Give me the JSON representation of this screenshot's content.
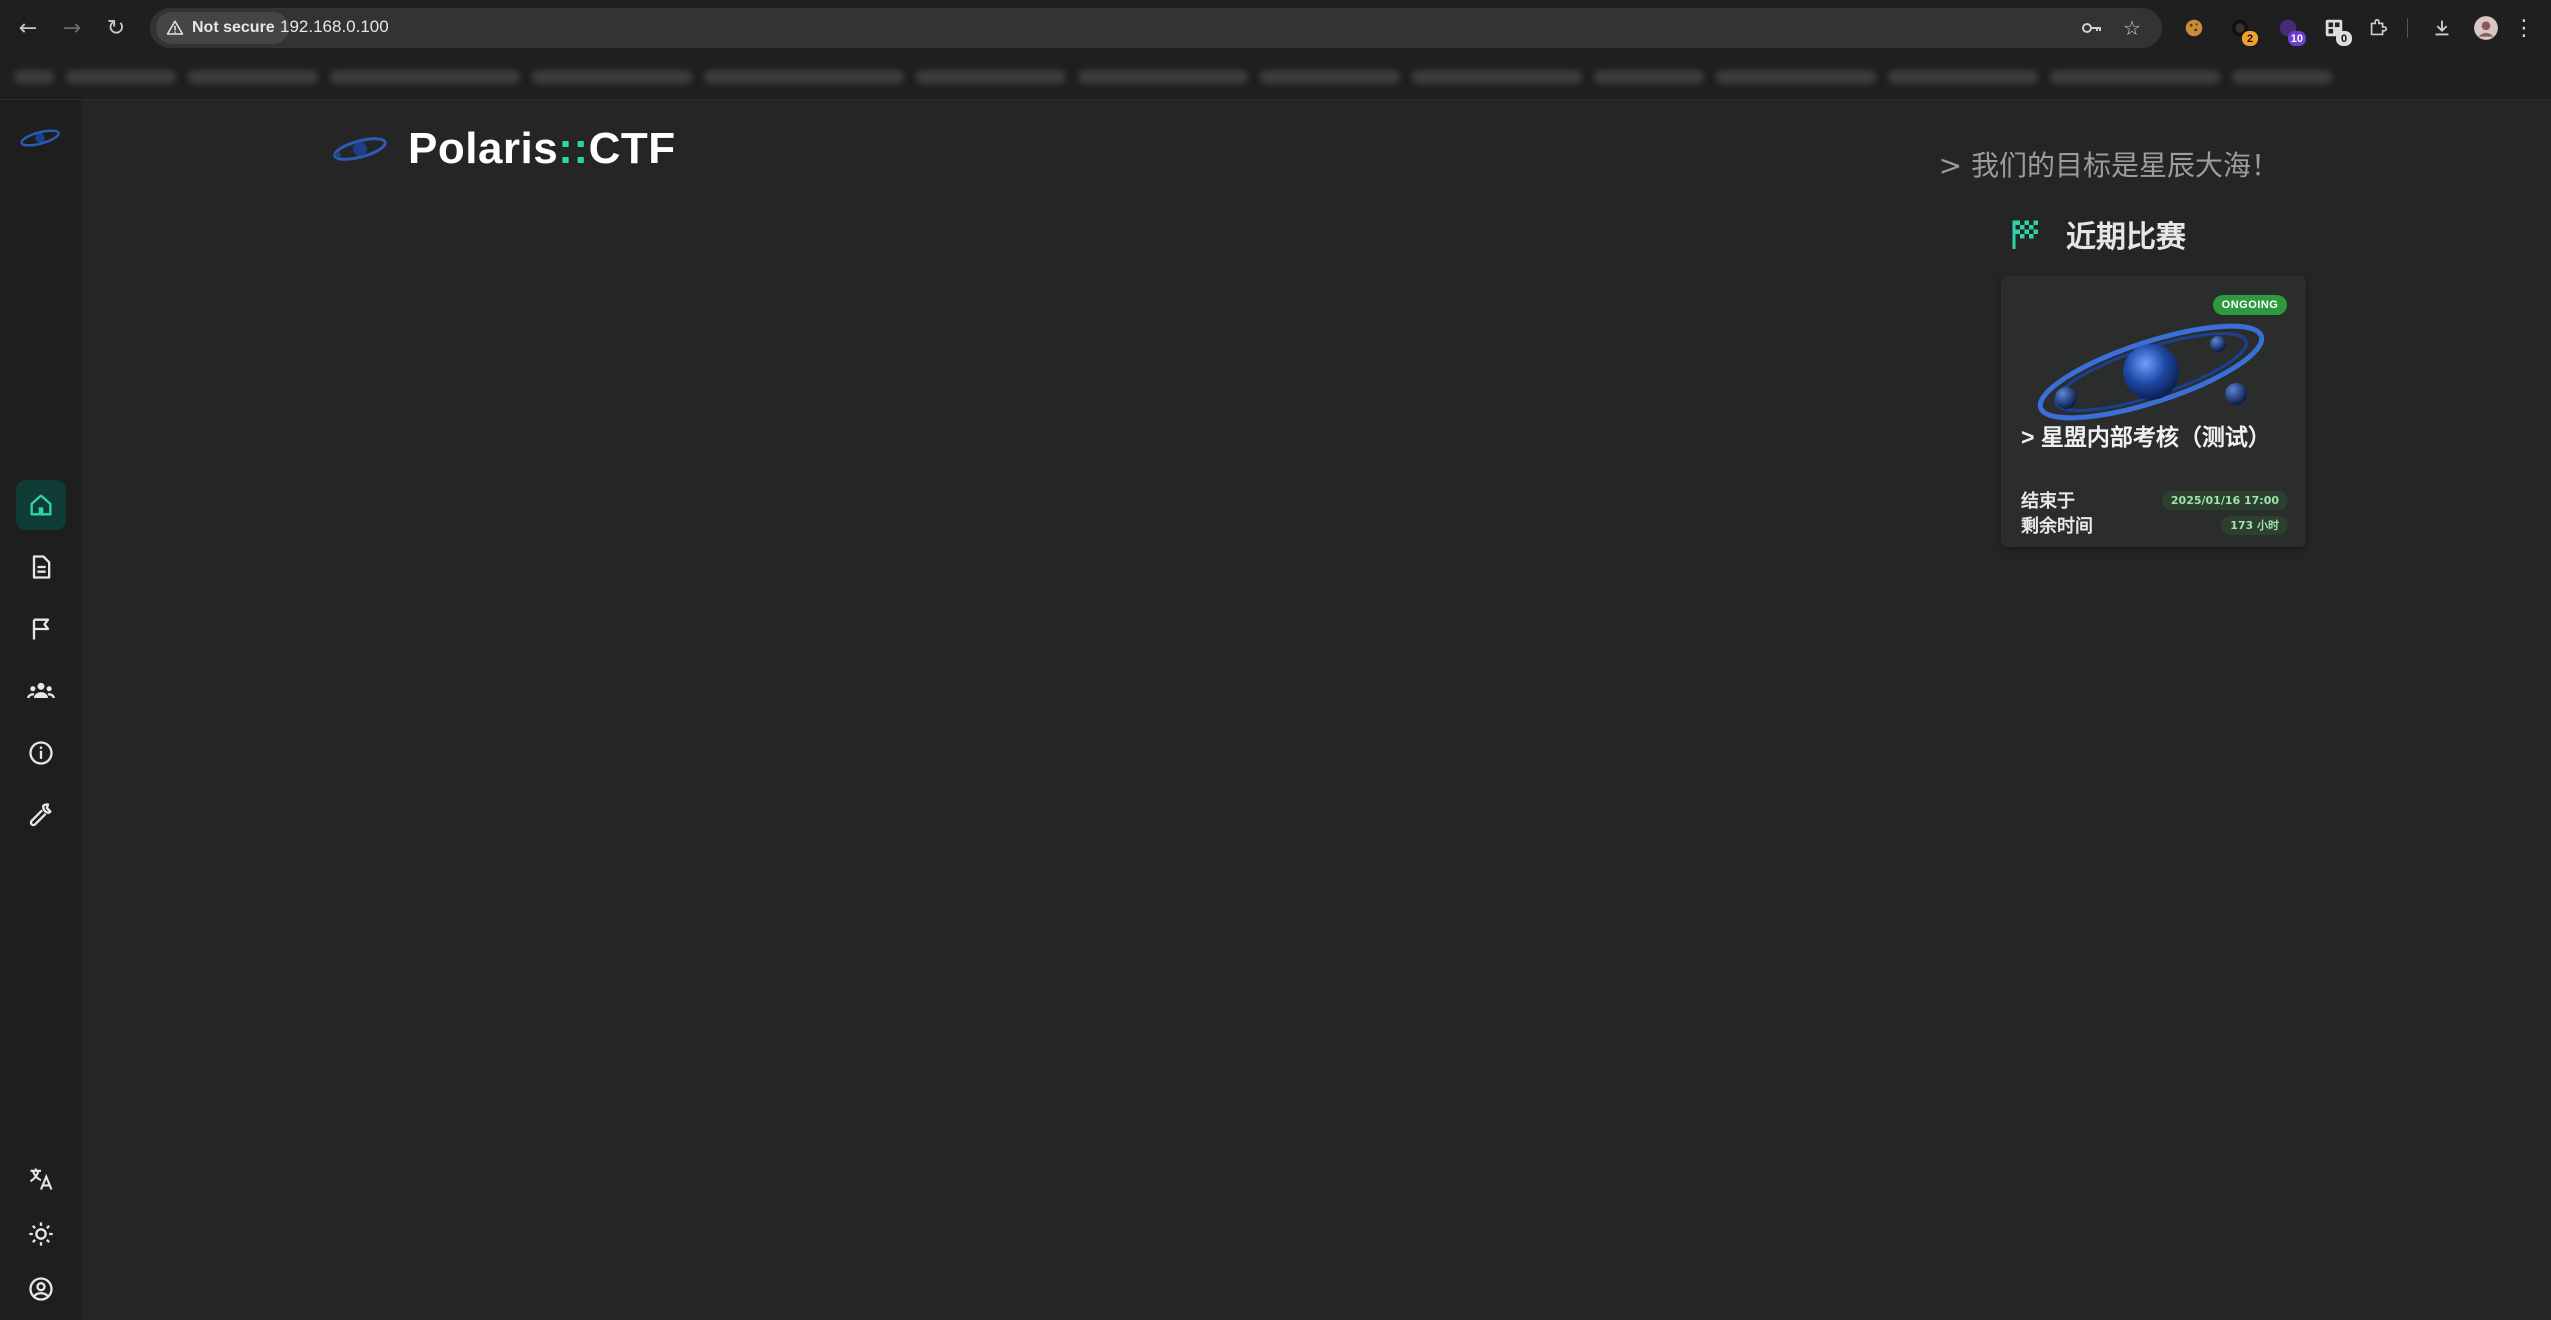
{
  "browser": {
    "security_label": "Not secure",
    "url": "192.168.0.100",
    "extensions": [
      {
        "name": "cookie-extension-icon",
        "badge": ""
      },
      {
        "name": "ext-2-icon",
        "badge": "2"
      },
      {
        "name": "ext-10-icon",
        "badge": "10"
      },
      {
        "name": "ext-0-icon",
        "badge": "0"
      }
    ]
  },
  "brand": {
    "name_left": "Polaris",
    "separator": "::",
    "name_right": "CTF"
  },
  "header": {
    "slogan": "> 我们的目标是星辰大海！"
  },
  "recent": {
    "title": "近期比赛",
    "card": {
      "status": "ONGOING",
      "title": "> 星盟内部考核（测试）",
      "end_label": "结束于",
      "end_value": "2025/01/16 17:00",
      "remaining_label": "剩余时间",
      "remaining_value": "173 小时"
    }
  },
  "colors": {
    "accent": "#2dd4a8",
    "status": "#2e9a3e"
  }
}
